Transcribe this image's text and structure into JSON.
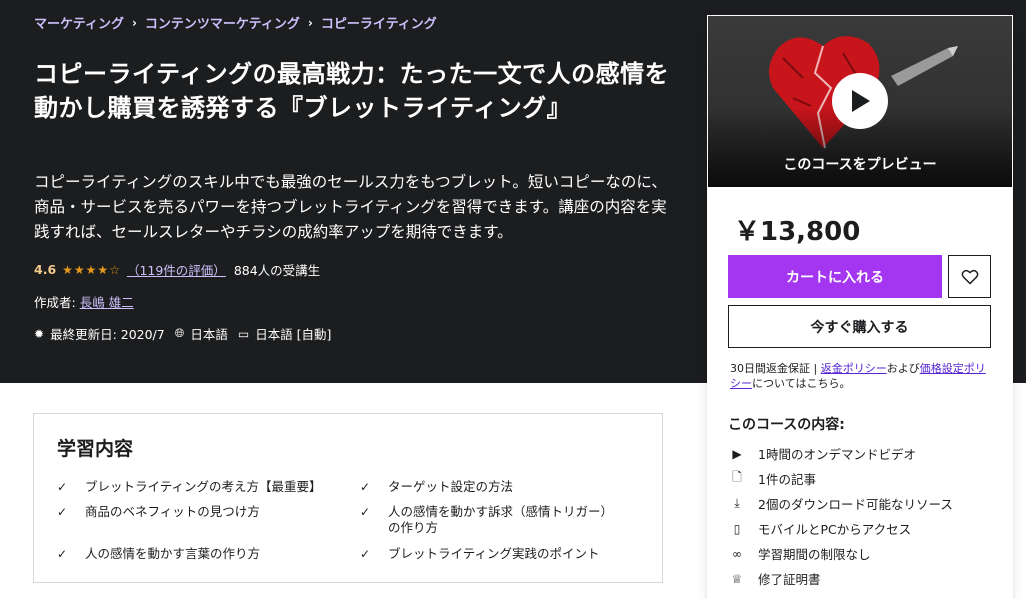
{
  "breadcrumb": [
    "マーケティング",
    "コンテンツマーケティング",
    "コピーライティング"
  ],
  "course": {
    "title": "コピーライティングの最高戦力：たった一文で人の感情を動かし購買を誘発する『ブレットライティング』",
    "subtitle": "コピーライティングのスキル中でも最強のセールス力をもつブレット。短いコピーなのに、商品・サービスを売るパワーを持つブレットライティングを習得できます。講座の内容を実践すれば、セールスレターやチラシの成約率アップを期待できます。",
    "rating": "4.6",
    "stars": 4.6,
    "reviews": "（119件の評価）",
    "students": "884人の受講生",
    "author_label": "作成者:",
    "author_name": "長嶋 雄二",
    "updated": "最終更新日: 2020/7",
    "language": "日本語",
    "captions": "日本語 [自動]"
  },
  "sidebar": {
    "preview_label": "このコースをプレビュー",
    "price": "￥13,800",
    "cart_label": "カートに入れる",
    "buy_label": "今すぐ購入する",
    "guarantee_prefix": "30日間返金保証",
    "refund_policy": "返金ポリシー",
    "and": "および",
    "pricing_policy": "価格設定ポリシー",
    "guarantee_suffix": "についてはこちら。",
    "includes_title": "このコースの内容:",
    "includes": [
      {
        "icon": "video-icon",
        "label": "1時間のオンデマンドビデオ"
      },
      {
        "icon": "article-icon",
        "label": "1件の記事"
      },
      {
        "icon": "download-icon",
        "label": "2個のダウンロード可能なリソース"
      },
      {
        "icon": "mobile-icon",
        "label": "モバイルとPCからアクセス"
      },
      {
        "icon": "infinity-icon",
        "label": "学習期間の制限なし"
      },
      {
        "icon": "trophy-icon",
        "label": "修了証明書"
      }
    ]
  },
  "learn": {
    "title": "学習内容",
    "items": [
      "ブレットライティングの考え方【最重要】",
      "商品のベネフィットの見つけ方",
      "人の感情を動かす言葉の作り方",
      "ターゲット設定の方法",
      "人の感情を動かす訴求（感情トリガー）の作り方",
      "ブレットライティング実践のポイント"
    ]
  },
  "colors": {
    "hero_bg": "#1c1d1f",
    "accent": "#a435f0",
    "link_light": "#cec0fc",
    "star": "#e59819",
    "rating_text": "#f3ca8c",
    "link": "#5624d0"
  }
}
